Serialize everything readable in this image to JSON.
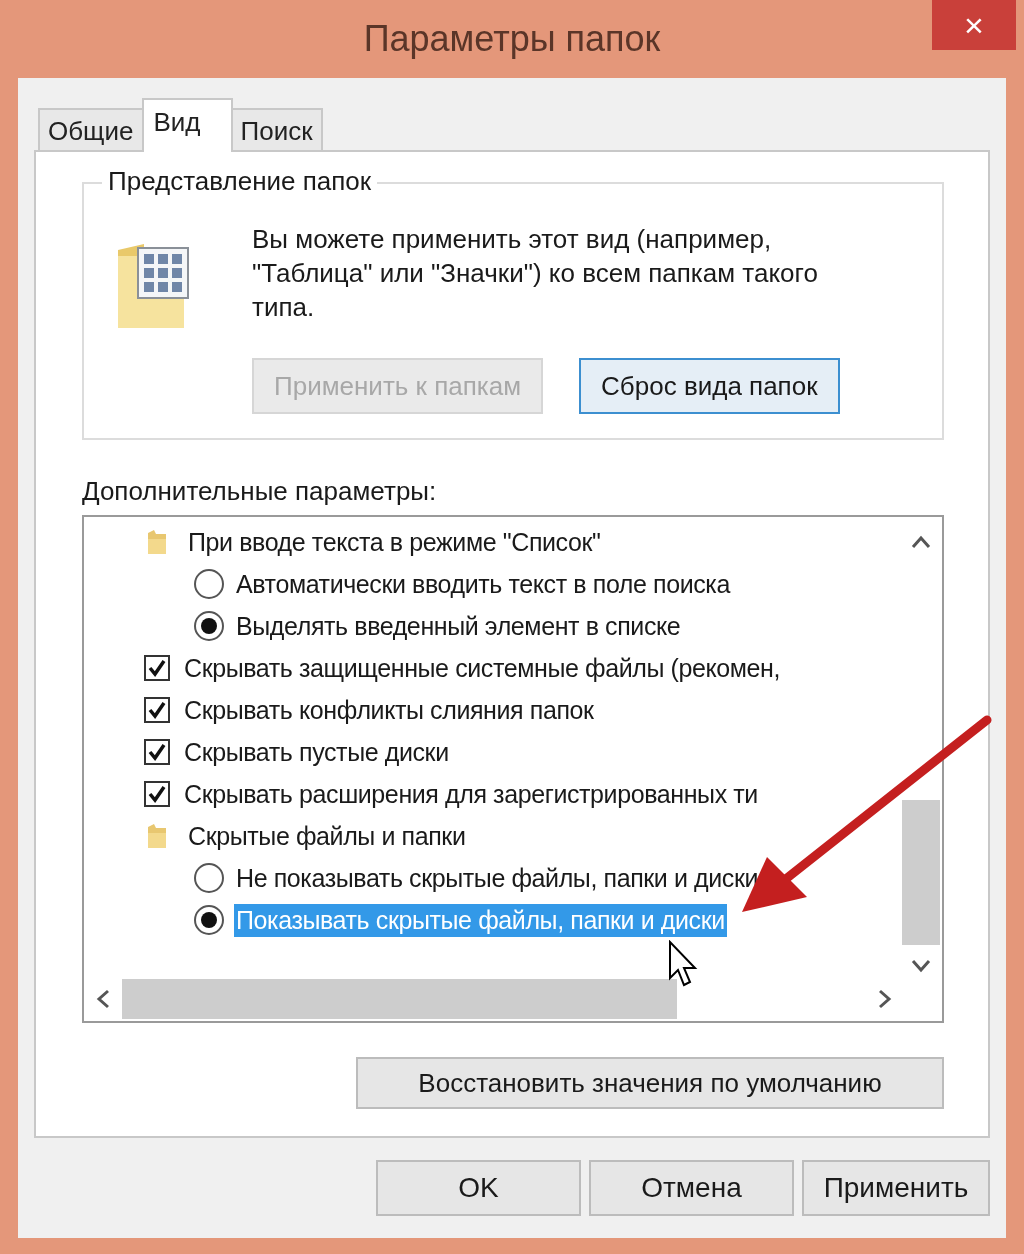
{
  "window": {
    "title": "Параметры папок",
    "close": "×"
  },
  "tabs": [
    {
      "label": "Общие",
      "selected": false
    },
    {
      "label": "Вид",
      "selected": true
    },
    {
      "label": "Поиск",
      "selected": false
    }
  ],
  "folder_views": {
    "legend": "Представление папок",
    "description": "Вы можете применить этот вид (например, \"Таблица\" или \"Значки\") ко всем папкам такого типа.",
    "buttons": [
      {
        "label": "Применить к папкам",
        "disabled": true
      },
      {
        "label": "Сброс вида папок",
        "disabled": false
      }
    ]
  },
  "advanced": {
    "label": "Дополнительные параметры:",
    "items": [
      {
        "kind": "folder",
        "label": "При вводе текста в режиме \"Список\"",
        "children": [
          {
            "kind": "radio",
            "label": "Автоматически вводить текст в поле поиска",
            "selected": false,
            "focused": false
          },
          {
            "kind": "radio",
            "label": "Выделять введенный элемент в списке",
            "selected": true,
            "focused": false
          }
        ]
      },
      {
        "kind": "checkbox",
        "label": "Скрывать защищенные системные файлы (рекомен,",
        "checked": true
      },
      {
        "kind": "checkbox",
        "label": "Скрывать конфликты слияния папок",
        "checked": true
      },
      {
        "kind": "checkbox",
        "label": "Скрывать пустые диски",
        "checked": true
      },
      {
        "kind": "checkbox",
        "label": "Скрывать расширения для зарегистрированных ти",
        "checked": true
      },
      {
        "kind": "folder",
        "label": "Скрытые файлы и папки",
        "children": [
          {
            "kind": "radio",
            "label": "Не показывать скрытые файлы, папки и диски",
            "selected": false,
            "focused": false
          },
          {
            "kind": "radio",
            "label": "Показывать скрытые файлы, папки и диски",
            "selected": true,
            "focused": true
          }
        ]
      }
    ],
    "restore_button": "Восстановить значения по умолчанию"
  },
  "buttons": [
    "OK",
    "Отмена",
    "Применить"
  ]
}
